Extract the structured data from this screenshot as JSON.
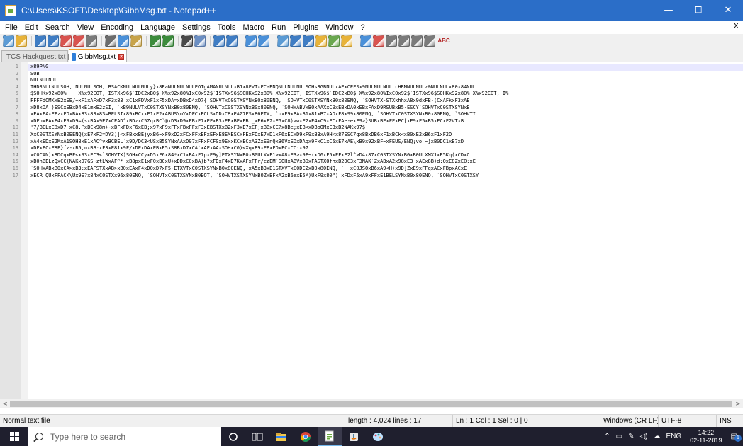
{
  "window": {
    "title": "C:\\Users\\KSOFT\\Desktop\\GibbMsg.txt - Notepad++",
    "controls": {
      "minimize": "—",
      "maximize": "⧠",
      "close": "✕"
    }
  },
  "menu": {
    "items": [
      "File",
      "Edit",
      "Search",
      "View",
      "Encoding",
      "Language",
      "Settings",
      "Tools",
      "Macro",
      "Run",
      "Plugins",
      "Window",
      "?"
    ],
    "close": "X"
  },
  "toolbar": {
    "icons": [
      "new-file-icon",
      "open-file-icon",
      "save-icon",
      "save-all-icon",
      "close-icon",
      "close-all-icon",
      "print-icon",
      "cut-icon",
      "copy-icon",
      "paste-icon",
      "undo-icon",
      "redo-icon",
      "find-icon",
      "replace-icon",
      "zoom-in-icon",
      "zoom-out-icon",
      "sync-vertical-icon",
      "sync-horizontal-icon",
      "word-wrap-icon",
      "show-all-chars-icon",
      "indent-guide-icon",
      "doc-map-icon",
      "function-list-icon",
      "folder-workspace-icon",
      "monitor-icon",
      "record-macro-icon",
      "stop-macro-icon",
      "play-macro-icon",
      "play-multiple-icon",
      "save-macro-icon",
      "spellcheck-icon"
    ],
    "spellcheck_label": "ABC"
  },
  "tabs": [
    {
      "label": "TCS Hackquest.txt",
      "active": false
    },
    {
      "label": "GibbMsg.txt",
      "active": true
    }
  ],
  "editor": {
    "lines": [
      {
        "num": "1",
        "text": "x89PNG"
      },
      {
        "num": "2",
        "text": "SUB"
      },
      {
        "num": "3",
        "text": "NULNULNUL"
      },
      {
        "num": "4",
        "text": "IHDRNULNULSOH, NULNULSOH, BSACKNULNULNULy}x8EaNULNULNULEOTgAMANULNULxB1x8FVTxFCaENQNULNULNULSOHsRGBNULxAExCEFSx9NULNULNUL cHRMNULNULz&NULNULx80x84NUL"
      },
      {
        "num": "5",
        "text": "$SOHKx92x80%    X%x92EOT, ISTXx96$`IDC2xB0$ X%x92x80%IxC0x92$`ISTXx96$SOHKx92x80% X%x92EOT, ISTXx96$`IDC2xB0$ X%x92x80%IxC0x92$`ISTXx96$SOHKx92x80% X%x92EOT, I%"
      },
      {
        "num": "6",
        "text": "FFFFdOMKxE2xEE/~xF1xAFxD7xF3x83_xC1xFDVxF1xF5xDA=xDBxD4xD7{`SOHVTxC0STXSYNxB0x80ENQ, `SOHVTxC0STXSYNxB0x80ENQ, `SOHVTX-STXkhhxA8x9dxFB-(CxAFkxF3xAE"
      },
      {
        "num": "7",
        "text": "xD8xDA|)ESCxEBxD4xE1mxE2zSI, `xB9NULVTxC0STXSYNxB0x80ENQ, `SOHVTxC0STXSYNxB0x80ENQ, `SOHxABVxB0xAAXxC9xEBxDA0xEBxFAxD9RSUBxB5-ESCY`SOHVTxC0STXSYNxB"
      },
      {
        "num": "8",
        "text": "xEAxFAxFFzxFDxBAx83x83x83=BELSIx89xBCxxF1xE2xABUS\\mYxDFCxFCLSxDDxC8xEAZ7FSx86ETX, `uxF9xBAxB1x81xB7xADxF8x99x80ENQ, `SOHVTxC0STXSYNxB0x80ENQ, `SOHVTI"
      },
      {
        "num": "9",
        "text": "xDFnxFAxF4xE9xD9=(sxBAx9E7xCEAD^xBDzxC5ZqxBC`@xD3xD9xFBxE7xEFxB3xEFxBExFB._xE6xF2xE5xC8)>wxF2xE4xC9xFCxFAe-exF9>}SUBxBExFFxEC[xF9xF5xB5xFCxF2VTxB"
      },
      {
        "num": "10",
        "text": "'7/BELxE8xD7_xC8.^xBCx98m+-xBFxFDxF6xEB;x97xF9xFFxFBxFFxF3xEBSTXxB2xF3xE7xCF;xBBxCE?x8Be;xEB<xDBoOMxE3xB2NAKx97$"
      },
      {
        "num": "11",
        "text": "XxC0STXSYNxB0EENQ(xE7xF2=DY3)]<xFBxxBEjyxB6~xF9xD2xFCxFFxEFxEFxE8EMESCxFExFDxE7xD1xF6xECxD9xF9xB3xA9H<x87ESC7gx8BxDB6xF1xBCk<xB0xE2xB6xF1xF2D"
      },
      {
        "num": "12",
        "text": "xA4xEDxE2MxA1SOH8xE1xAC^vxBCBEL`x9D/DC3<USxB5SYNxAAxD97xFFxFCFSx9ExxKCxECxA3ZxE9nQxB6VxEDxDAqx9FxC1xC5xE7xAE\\xB9x92xBF~xFEUS/ENQ;vo_~}xB0DC1xB7xD"
      },
      {
        "num": "13",
        "text": "xDFxECxF8F}fz-xB5,nxBB:xF3xE81x9F/xDExDAxEBxE5xS8BxD7xCA`xAFxAAxSOHxC0)<XqxB9xEExFDxFCxCC:x97"
      },
      {
        "num": "14",
        "text": "xC0CAN)x8DCqxBF<x93xEC3<`SOHVTX)SOHxCCyxD5xF6x84*xC1xBAxF7pxE9y]ETXSYNxB0xB0ULXxF1>xA8xE3>x9F~(xD6xF5xFFxE2l^>D4x87xC0STXSYNxB0xB0ULXMX1xE5Kq(xCDxC"
      },
      {
        "num": "15",
        "text": "xB0nBELzQxCC(NAKxD7GS~ztLWxAF^*_xB8pxE1xF0xBCxU+xDDxC0xBA)b?xFDxF4xD7KxAFxFFr/czEM`SOHxABVxB0xFASTXOfhxB2DC3xF3NAK`ZxABxA2x98xE3~xAEx8B)d:OxE8ZxE0:xE"
      },
      {
        "num": "16",
        "text": "`SOHxABxB0xCA>xB3:xEAFSTXxAB>xB0xEAxF4xD0xD7xF5-ETXVTxC0STXSYNxB0x80ENQ, xA5xB3xB1STXVTxC0DC2xB0x80ENQ, `  xC0JSOxB6xA9<H)x9D]ZxE9xFFqxACxFBpxACxE"
      },
      {
        "num": "17",
        "text": "xECR_QUxFFACK\\Ux9E?x84xC0STXx96x80ENQ, `SOHVTxC0STXSYNxB0EOT, `SOHVTXSTXSYNxB0ZxBFxA2xB6exE5M)UxF9x80\") xFDxF5xA9xFFxE1BELSYNxB0x80ENQ, `SOHVTxC0STXSY"
      }
    ]
  },
  "scrollbar": {
    "left_arrow": "<",
    "right_arrow": ">"
  },
  "status": {
    "file_type": "Normal text file",
    "length": "length : 4,024   lines : 17",
    "position": "Ln : 1   Col : 1   Sel : 0 | 0",
    "eol": "Windows (CR LF)",
    "encoding": "UTF-8",
    "mode": "INS"
  },
  "taskbar": {
    "search_placeholder": "Type here to search",
    "tray_lang": "ENG",
    "time": "14:22",
    "date": "02-11-2019",
    "notification_count": "1"
  }
}
